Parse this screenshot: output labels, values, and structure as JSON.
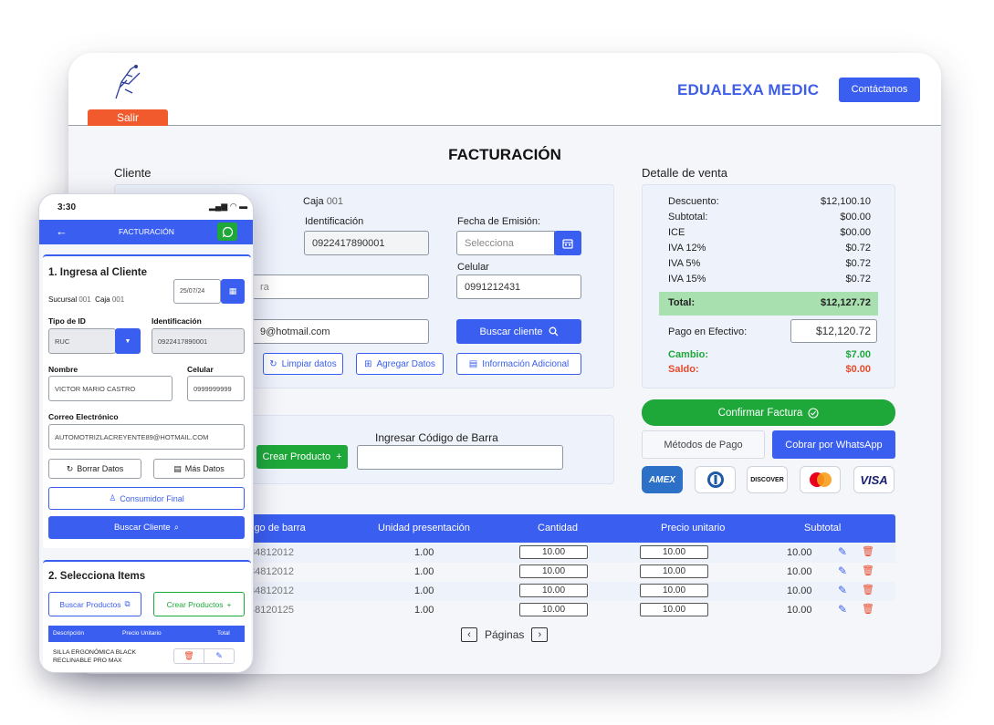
{
  "desktop": {
    "logout_label": "Salir",
    "brand": "EDUALEXA MEDIC",
    "contact_label": "Contáctanos",
    "page_title": "FACTURACIÓN",
    "client": {
      "section_title": "Cliente",
      "caja_label": "Caja",
      "caja_value": "001",
      "id_label": "Identificación",
      "id_value": "0922417890001",
      "date_label": "Fecha de Emisión:",
      "date_placeholder": "Selecciona",
      "celular_label": "Celular",
      "celular_value": "0991212431",
      "name_partial": "ra",
      "email_partial": "9@hotmail.com",
      "search_client": "Buscar cliente",
      "clear_data": "Limpiar datos",
      "add_data": "Agregar Datos",
      "extra_info": "Información Adicional"
    },
    "barcode": {
      "create_product": "Crear Producto",
      "label": "Ingresar Código de Barra",
      "value": ""
    },
    "sale": {
      "section_title": "Detalle de venta",
      "rows": [
        {
          "label": "Descuento:",
          "value": "$12,100.10"
        },
        {
          "label": "Subtotal:",
          "value": "$00.00"
        },
        {
          "label": "ICE",
          "value": "$00.00"
        },
        {
          "label": "IVA 12%",
          "value": "$0.72"
        },
        {
          "label": "IVA 5%",
          "value": "$0.72"
        },
        {
          "label": "IVA 15%",
          "value": "$0.72"
        }
      ],
      "total_label": "Total:",
      "total_value": "$12,127.72",
      "cash_label": "Pago en Efectivo:",
      "cash_value": "$12,120.72",
      "change_label": "Cambio:",
      "change_value": "$7.00",
      "balance_label": "Saldo:",
      "balance_value": "$0.00",
      "confirm": "Confirmar Factura",
      "payment_methods": "Métodos de Pago",
      "whatsapp": "Cobrar por WhatsApp",
      "cards": [
        "AMEX",
        "Diners",
        "DISCOVER",
        "Mastercard",
        "VISA"
      ]
    },
    "table": {
      "headers": [
        "igo de barra",
        "Unidad presentación",
        "Cantidad",
        "Precio unitario",
        "Subtotal"
      ],
      "rows": [
        {
          "code": "34812012",
          "unit": "1.00",
          "qty": "10.00",
          "price": "10.00",
          "subtotal": "10.00"
        },
        {
          "code": "34812012",
          "unit": "1.00",
          "qty": "10.00",
          "price": "10.00",
          "subtotal": "10.00"
        },
        {
          "code": "34812012",
          "unit": "1.00",
          "qty": "10.00",
          "price": "10.00",
          "subtotal": "10.00"
        },
        {
          "code": "48120125",
          "unit": "1.00",
          "qty": "10.00",
          "price": "10.00",
          "subtotal": "10.00"
        }
      ],
      "pages_label": "Páginas"
    }
  },
  "phone": {
    "time": "3:30",
    "title": "FACTURACIÓN",
    "step1": "1. Ingresa al Cliente",
    "date_value": "25/07/24",
    "sucursal_label": "Sucursal",
    "sucursal_value": "001",
    "caja_label": "Caja",
    "caja_value": "001",
    "id_type_label": "Tipo de ID",
    "id_type_value": "RUC",
    "id_label": "Identificación",
    "id_value": "0922417890001",
    "name_label": "Nombre",
    "name_value": "VICTOR MARIO CASTRO",
    "cel_label": "Celular",
    "cel_value": "0999999999",
    "email_label": "Correo Electrónico",
    "email_value": "AUTOMOTRIZLACREYENTE89@HOTMAIL.COM",
    "clear": "Borrar Datos",
    "more": "Más Datos",
    "final_consumer": "Consumidor Final",
    "search_client": "Buscar Cliente",
    "step2": "2. Selecciona Items",
    "search_products": "Buscar Productos",
    "create_products": "Crear Productos",
    "table_headers": [
      "Descripción",
      "Precio Unitario",
      "Total"
    ],
    "item_desc": "SILLA ERGONÓMICA BLACK RECLINABLE PRO MAX"
  },
  "colors": {
    "accent": "#3a5ef0",
    "danger": "#f05a2c",
    "success": "#1ea83a",
    "total_bg": "#a8e0b0"
  }
}
